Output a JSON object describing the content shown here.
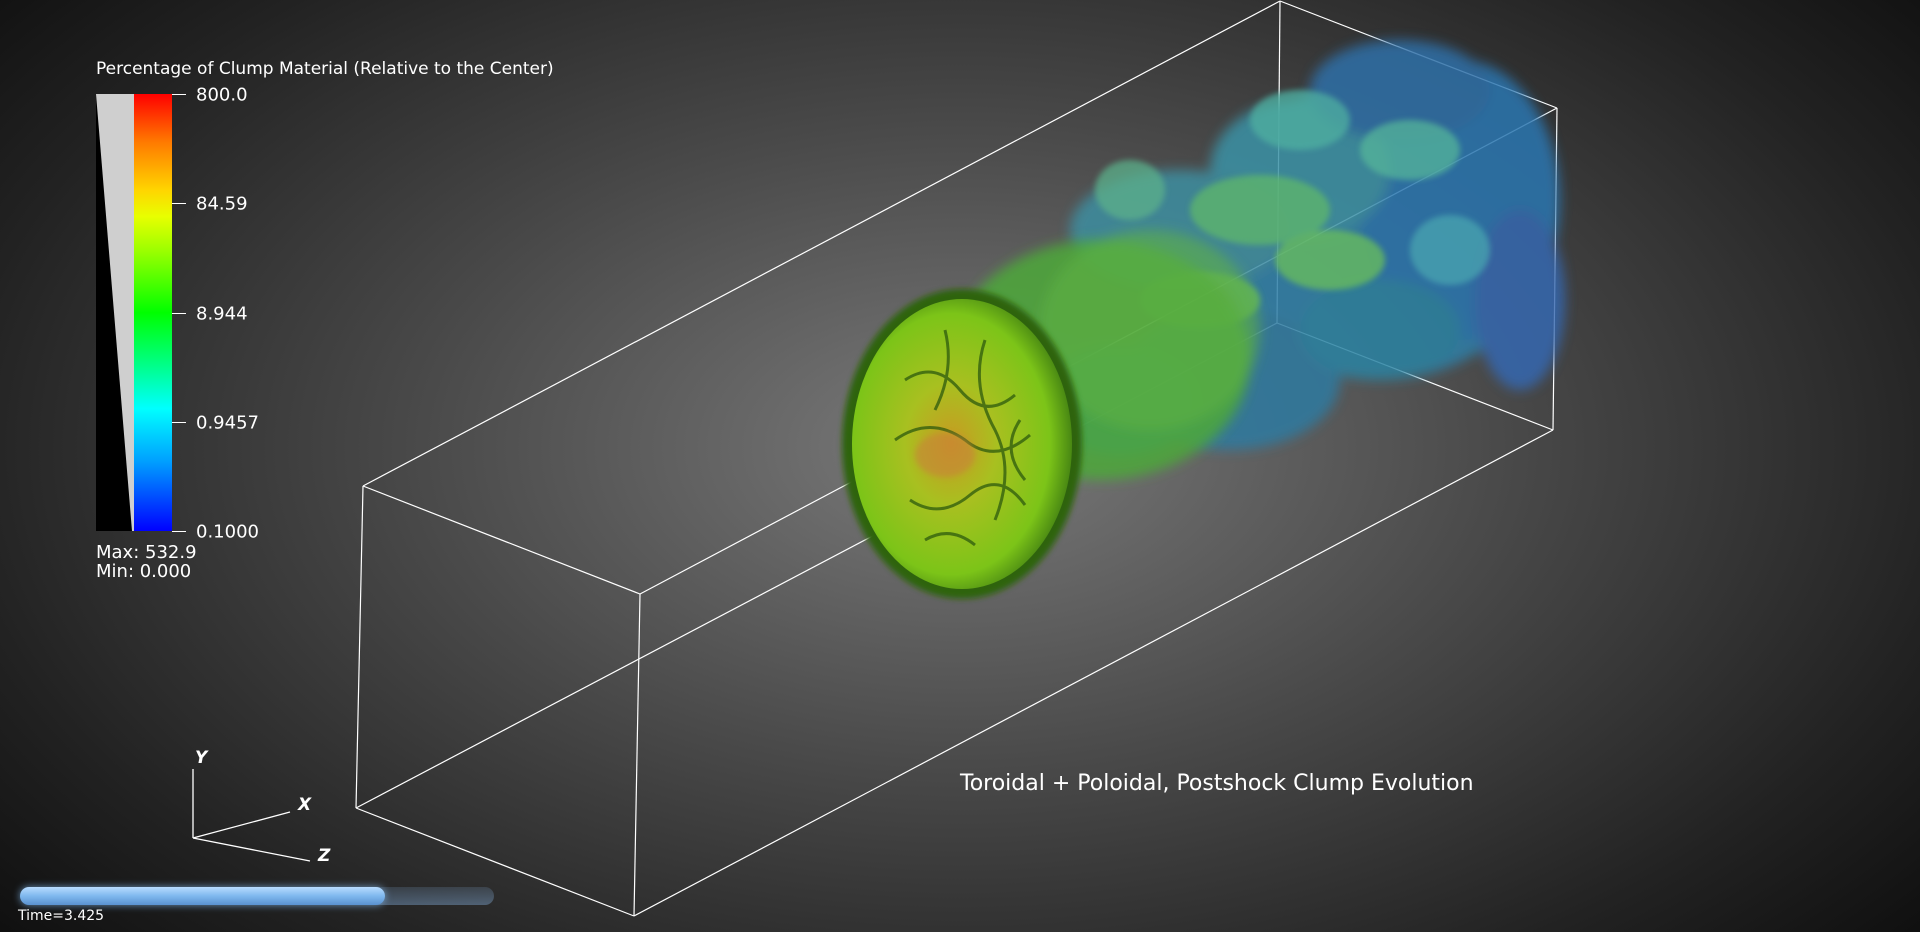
{
  "legend": {
    "title": "Percentage of Clump Material (Relative to the Center)",
    "ticks": [
      "800.0",
      "84.59",
      "8.944",
      "0.9457",
      "0.1000"
    ],
    "max_label": "Max:  532.9",
    "min_label": "Min:  0.000"
  },
  "axes": {
    "y": "Y",
    "x": "X",
    "z": "Z"
  },
  "caption": "Toroidal + Poloidal, Postshock Clump Evolution",
  "time": {
    "label": "Time=3.425",
    "progress": 0.77
  },
  "colors": {
    "colormap_top": "#ff0000",
    "colormap_bottom": "#0000ff",
    "box_lines": "#ffffff"
  }
}
